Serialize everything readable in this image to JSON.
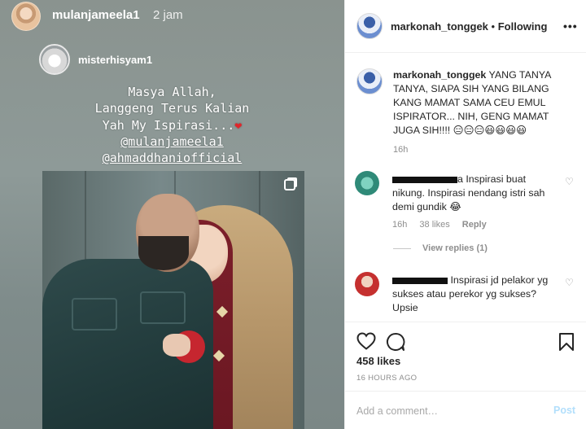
{
  "story": {
    "username": "mulanjameela1",
    "time": "2 jam",
    "repost_username": "misterhisyam1",
    "caption_lines": [
      "Masya Allah,",
      "Langgeng Terus Kalian",
      "Yah My Ispirasi...",
      "@mulanjameela1",
      "@ahmaddhaniofficial"
    ],
    "heart_emoji": "❤"
  },
  "post": {
    "author": "markonah_tonggek",
    "follow_status": "Following",
    "header_separator": "•",
    "more_glyph": "•••",
    "caption_text": "YANG TANYA TANYA, SIAPA SIH YANG BILANG KANG MAMAT SAMA CEU EMUL ISPIRATOR... NIH, GENG MAMAT JUGA SIH!!!! 😑😑😑😃😃😃😃",
    "caption_time": "16h"
  },
  "comments": [
    {
      "text": "a Inspirasi buat nikung. Inspirasi nendang istri sah demi gundik 😂",
      "time": "16h",
      "likes": "38 likes",
      "reply_label": "Reply",
      "view_replies": "View replies (1)"
    },
    {
      "text": "Inspirasi jd pelakor yg sukses atau perekor yg sukses? Upsie"
    }
  ],
  "actions": {
    "likes": "458 likes",
    "timestamp": "16 HOURS AGO",
    "comment_placeholder": "Add a comment…",
    "post_label": "Post"
  },
  "colors": {
    "link_disabled": "#b2dffc",
    "muted": "#8e8e8e",
    "heart": "#e0262b"
  }
}
